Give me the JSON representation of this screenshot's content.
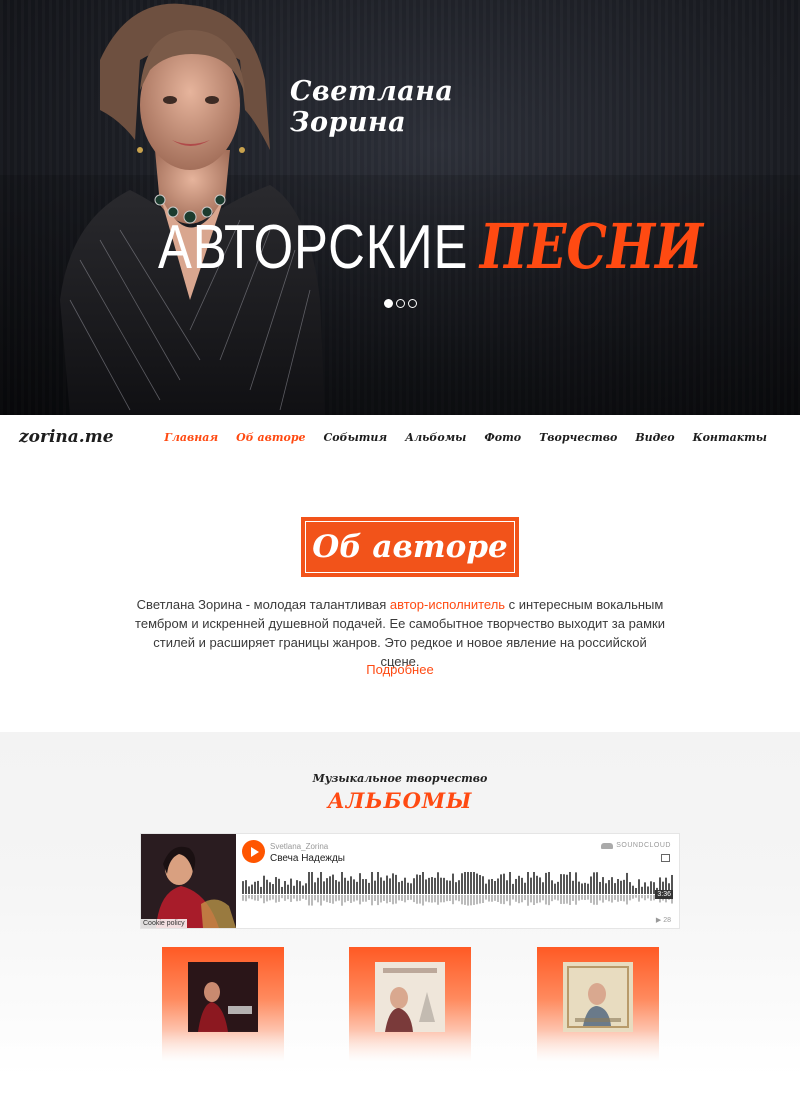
{
  "hero": {
    "name": "Светлана Зорина",
    "title_plain": "АВТОРСКИЕ",
    "title_accent": "ПЕСНИ",
    "slider": {
      "count": 3,
      "active": 0
    }
  },
  "nav": {
    "logo": "zorina.me",
    "items": [
      {
        "label": "Главная",
        "active": true
      },
      {
        "label": "Об авторе",
        "active": true
      },
      {
        "label": "События",
        "active": false
      },
      {
        "label": "Альбомы",
        "active": false
      },
      {
        "label": "Фото",
        "active": false
      },
      {
        "label": "Творчество",
        "active": false
      },
      {
        "label": "Видео",
        "active": false
      },
      {
        "label": "Контакты",
        "active": false
      }
    ]
  },
  "about": {
    "heading": "Об авторе",
    "text_before": "Светлана Зорина - молодая талантливая ",
    "text_link": "автор-исполнитель",
    "text_after": " с интересным вокальным тембром и искренней душевной подачей. Ее самобытное творчество выходит за рамки стилей и расширяет границы жанров. Это редкое и новое явление на российской сцене.",
    "more": "Подробнее"
  },
  "albums": {
    "subtitle": "Музыкальное творчество",
    "title": "АЛЬБОМЫ"
  },
  "player": {
    "user": "Svetlana_Zorina",
    "track": "Свеча Надежды",
    "brand": "SOUNDCLOUD",
    "duration": "3:36",
    "plays": "▶ 28",
    "cookie": "Cookie policy"
  },
  "colors": {
    "accent": "#ff4a12",
    "soundcloud": "#ff5500"
  }
}
